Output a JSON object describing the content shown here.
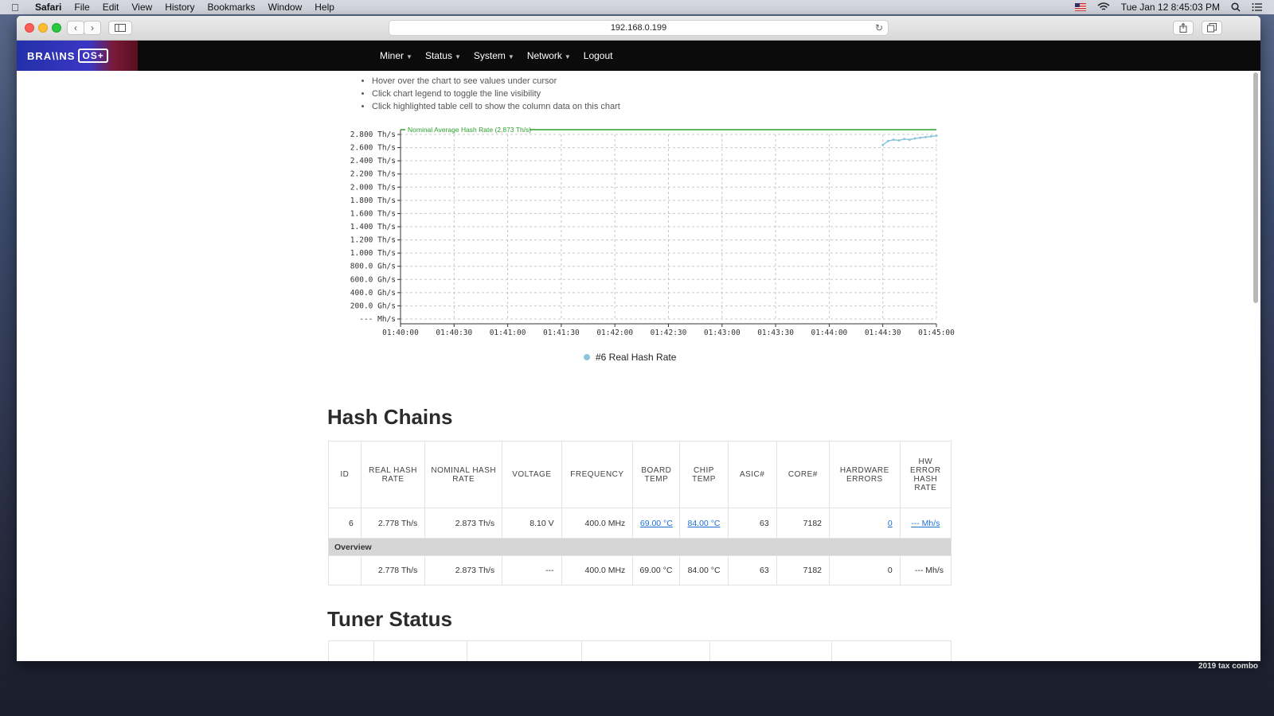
{
  "menubar": {
    "app": "Safari",
    "items": [
      "File",
      "Edit",
      "View",
      "History",
      "Bookmarks",
      "Window",
      "Help"
    ],
    "clock": "Tue Jan 12  8:45:03 PM"
  },
  "browser": {
    "url": "192.168.0.199"
  },
  "nav": {
    "logo": "BRA\\\\NS",
    "logo_os": "OS+",
    "items": [
      {
        "label": "Miner",
        "dropdown": true
      },
      {
        "label": "Status",
        "dropdown": true
      },
      {
        "label": "System",
        "dropdown": true
      },
      {
        "label": "Network",
        "dropdown": true
      },
      {
        "label": "Logout",
        "dropdown": false
      }
    ]
  },
  "tips": [
    "Hover over the chart to see values under cursor",
    "Click chart legend to toggle the line visibility",
    "Click highlighted table cell to show the column data on this chart"
  ],
  "chart_data": {
    "type": "line",
    "y_ticks": [
      "2.800 Th/s",
      "2.600 Th/s",
      "2.400 Th/s",
      "2.200 Th/s",
      "2.000 Th/s",
      "1.800 Th/s",
      "1.600 Th/s",
      "1.400 Th/s",
      "1.200 Th/s",
      "1.000 Th/s",
      "800.0 Gh/s",
      "600.0 Gh/s",
      "400.0 Gh/s",
      "200.0 Gh/s",
      "--- Mh/s"
    ],
    "x_ticks": [
      "01:40:00",
      "01:40:30",
      "01:41:00",
      "01:41:30",
      "01:42:00",
      "01:42:30",
      "01:43:00",
      "01:43:30",
      "01:44:00",
      "01:44:30",
      "01:45:00"
    ],
    "ylim": [
      0,
      2.8
    ],
    "reference_line": {
      "label": "Nominal Average Hash Rate (2.873 Th/s)",
      "value": 2.873,
      "color": "#2ca02c"
    },
    "series": [
      {
        "name": "#6 Real Hash Rate",
        "color": "#8ec5da",
        "points": [
          [
            "01:44:30",
            2.64
          ],
          [
            "01:44:33",
            2.7
          ],
          [
            "01:44:36",
            2.72
          ],
          [
            "01:44:39",
            2.71
          ],
          [
            "01:44:42",
            2.73
          ],
          [
            "01:44:45",
            2.72
          ],
          [
            "01:44:48",
            2.74
          ],
          [
            "01:44:51",
            2.75
          ],
          [
            "01:44:54",
            2.76
          ],
          [
            "01:44:57",
            2.77
          ],
          [
            "01:45:00",
            2.78
          ]
        ]
      }
    ],
    "grid": true
  },
  "legend_label": "#6 Real Hash Rate",
  "hash_chains": {
    "title": "Hash Chains",
    "headers": [
      "ID",
      "REAL HASH RATE",
      "NOMINAL HASH RATE",
      "VOLTAGE",
      "FREQUENCY",
      "BOARD TEMP",
      "CHIP TEMP",
      "ASIC#",
      "CORE#",
      "HARDWARE ERRORS",
      "HW ERROR HASH RATE"
    ],
    "row": {
      "id": "6",
      "real": "2.778 Th/s",
      "nominal": "2.873 Th/s",
      "voltage": "8.10 V",
      "freq": "400.0 MHz",
      "board_temp": "69.00 °C",
      "chip_temp": "84.00 °C",
      "asic": "63",
      "core": "7182",
      "hw_errors": "0",
      "hw_rate": "--- Mh/s"
    },
    "overview_label": "Overview",
    "overview": {
      "id": "",
      "real": "2.778 Th/s",
      "nominal": "2.873 Th/s",
      "voltage": "---",
      "freq": "400.0 MHz",
      "board_temp": "69.00 °C",
      "chip_temp": "84.00 °C",
      "asic": "63",
      "core": "7182",
      "hw_errors": "0",
      "hw_rate": "--- Mh/s"
    }
  },
  "tuner_title": "Tuner Status",
  "desktop_label": "2019 tax combo"
}
